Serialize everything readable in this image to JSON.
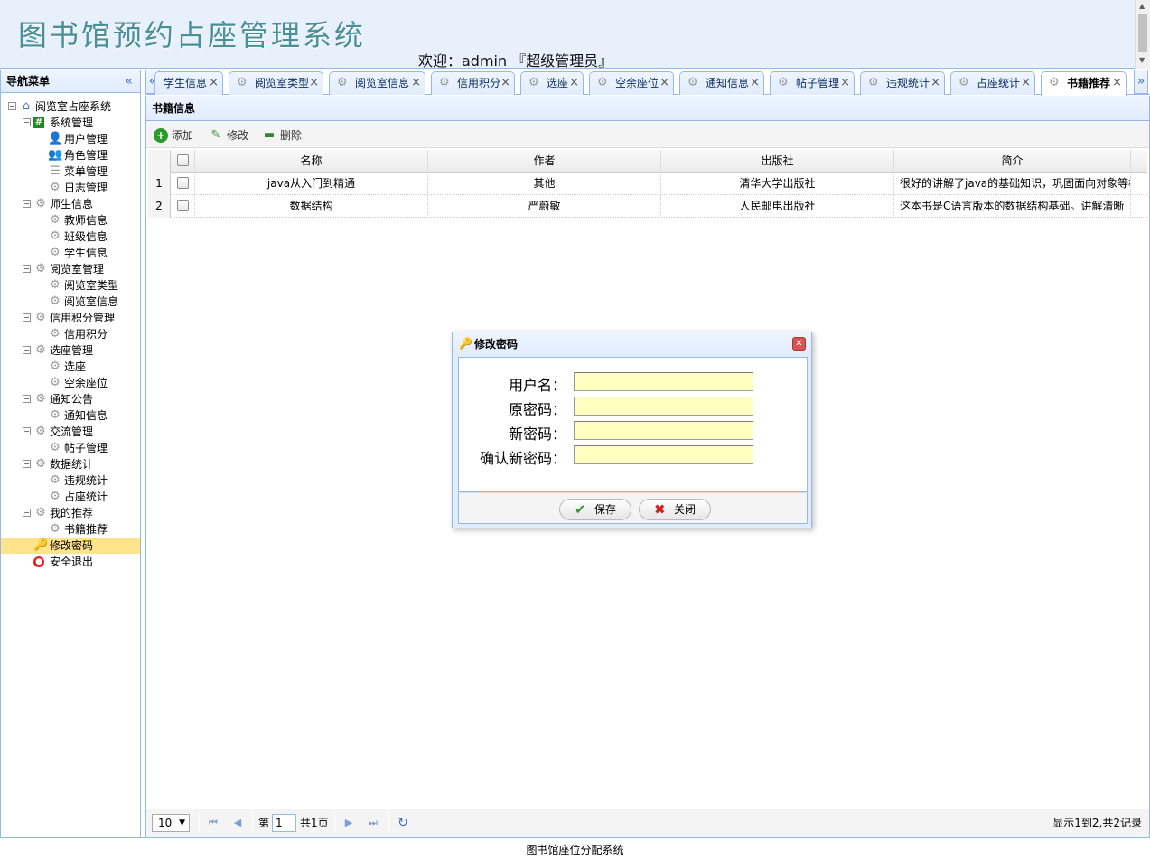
{
  "header": {
    "logo": "图书馆预约占座管理系统",
    "welcome": "欢迎：admin 『超级管理员』"
  },
  "nav": {
    "title": "导航菜单",
    "collapse": "«",
    "tree": [
      {
        "label": "阅览室占座系统",
        "level": 0,
        "icon": "home-icon",
        "expanded": true
      },
      {
        "label": "系统管理",
        "level": 1,
        "icon": "hash-icon",
        "expanded": true
      },
      {
        "label": "用户管理",
        "level": 2,
        "icon": "user-icon"
      },
      {
        "label": "角色管理",
        "level": 2,
        "icon": "users-icon"
      },
      {
        "label": "菜单管理",
        "level": 2,
        "icon": "menu-icon"
      },
      {
        "label": "日志管理",
        "level": 2,
        "icon": "gear-icon"
      },
      {
        "label": "师生信息",
        "level": 1,
        "icon": "gear-icon",
        "expanded": true
      },
      {
        "label": "教师信息",
        "level": 2,
        "icon": "gear-icon"
      },
      {
        "label": "班级信息",
        "level": 2,
        "icon": "gear-icon"
      },
      {
        "label": "学生信息",
        "level": 2,
        "icon": "gear-icon"
      },
      {
        "label": "阅览室管理",
        "level": 1,
        "icon": "gear-icon",
        "expanded": true
      },
      {
        "label": "阅览室类型",
        "level": 2,
        "icon": "gear-icon"
      },
      {
        "label": "阅览室信息",
        "level": 2,
        "icon": "gear-icon"
      },
      {
        "label": "信用积分管理",
        "level": 1,
        "icon": "gear-icon",
        "expanded": true
      },
      {
        "label": "信用积分",
        "level": 2,
        "icon": "gear-icon"
      },
      {
        "label": "选座管理",
        "level": 1,
        "icon": "gear-icon",
        "expanded": true
      },
      {
        "label": "选座",
        "level": 2,
        "icon": "gear-icon"
      },
      {
        "label": "空余座位",
        "level": 2,
        "icon": "gear-icon"
      },
      {
        "label": "通知公告",
        "level": 1,
        "icon": "gear-icon",
        "expanded": true
      },
      {
        "label": "通知信息",
        "level": 2,
        "icon": "gear-icon"
      },
      {
        "label": "交流管理",
        "level": 1,
        "icon": "gear-icon",
        "expanded": true
      },
      {
        "label": "帖子管理",
        "level": 2,
        "icon": "gear-icon"
      },
      {
        "label": "数据统计",
        "level": 1,
        "icon": "gear-icon",
        "expanded": true
      },
      {
        "label": "违规统计",
        "level": 2,
        "icon": "gear-icon"
      },
      {
        "label": "占座统计",
        "level": 2,
        "icon": "gear-icon"
      },
      {
        "label": "我的推荐",
        "level": 1,
        "icon": "gear-icon",
        "expanded": true
      },
      {
        "label": "书籍推荐",
        "level": 2,
        "icon": "gear-icon"
      },
      {
        "label": "修改密码",
        "level": 1,
        "icon": "key-icon",
        "selected": true
      },
      {
        "label": "安全退出",
        "level": 1,
        "icon": "exit-icon"
      }
    ]
  },
  "tabs": {
    "scroll_left": "«",
    "scroll_right": "»",
    "items": [
      {
        "label": "学生信息",
        "close": "×"
      },
      {
        "label": "阅览室类型",
        "close": "×"
      },
      {
        "label": "阅览室信息",
        "close": "×"
      },
      {
        "label": "信用积分",
        "close": "×"
      },
      {
        "label": "选座",
        "close": "×"
      },
      {
        "label": "空余座位",
        "close": "×"
      },
      {
        "label": "通知信息",
        "close": "×"
      },
      {
        "label": "帖子管理",
        "close": "×"
      },
      {
        "label": "违规统计",
        "close": "×"
      },
      {
        "label": "占座统计",
        "close": "×"
      },
      {
        "label": "书籍推荐",
        "close": "×",
        "active": true
      }
    ]
  },
  "panel": {
    "title": "书籍信息",
    "toolbar": {
      "add": "添加",
      "edit": "修改",
      "delete": "删除"
    },
    "columns": [
      "名称",
      "作者",
      "出版社",
      "简介"
    ],
    "rows": [
      {
        "num": "1",
        "name": "java从入门到精通",
        "author": "其他",
        "publisher": "清华大学出版社",
        "intro": "很好的讲解了java的基础知识，巩固面向对象等核"
      },
      {
        "num": "2",
        "name": "数据结构",
        "author": "严蔚敏",
        "publisher": "人民邮电出版社",
        "intro": "这本书是C语言版本的数据结构基础。讲解清晰"
      }
    ],
    "pager": {
      "page_size": "10",
      "page_prefix": "第",
      "page_value": "1",
      "page_total": "共1页",
      "info": "显示1到2,共2记录"
    }
  },
  "dialog": {
    "title": "修改密码",
    "close": "✕",
    "fields": [
      {
        "label": "用户名：",
        "value": ""
      },
      {
        "label": "原密码：",
        "value": ""
      },
      {
        "label": "新密码：",
        "value": ""
      },
      {
        "label": "确认新密码：",
        "value": ""
      }
    ],
    "save": "保存",
    "cancel": "关闭"
  },
  "footer": {
    "text": "图书馆座位分配系统"
  },
  "colors": {
    "border": "#95b8e7",
    "header_bg": "#e7f0fb",
    "selected": "#ffe48d",
    "input_bg": "#ffffc0"
  }
}
